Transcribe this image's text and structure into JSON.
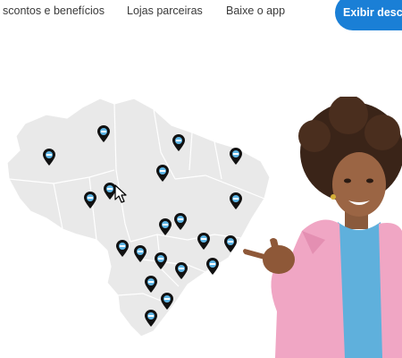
{
  "nav": {
    "links": [
      {
        "label": "scontos e benefícios"
      },
      {
        "label": "Lojas parceiras"
      },
      {
        "label": "Baixe o app"
      }
    ],
    "cta_label": "Exibir desc",
    "cta_color": "#1a7fd6"
  },
  "map": {
    "region": "Brazil",
    "fill_color": "#e9e9e9",
    "pin_color": "#111111",
    "pin_icon": "map-pin-icon",
    "pin_count": 20
  },
  "hero": {
    "image": "woman-pointing-illustration"
  }
}
